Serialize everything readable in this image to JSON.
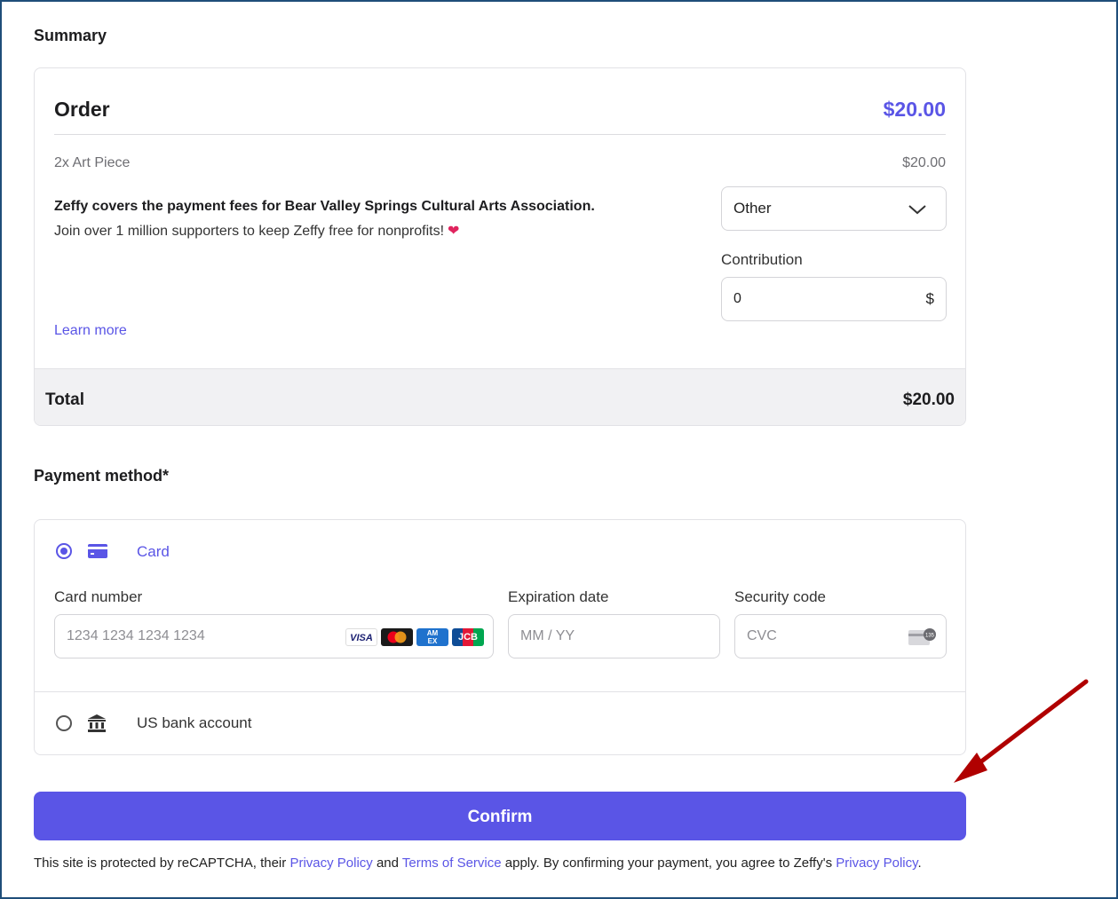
{
  "summary": {
    "title": "Summary",
    "order": {
      "title": "Order",
      "amount": "$20.00",
      "item_name": "2x Art Piece",
      "item_price": "$20.00",
      "fee_bold": "Zeffy covers the payment fees for Bear Valley Springs Cultural Arts Association.",
      "fee_text": "Join over 1 million supporters to keep Zeffy free for nonprofits!",
      "heart_icon": "heart-icon",
      "learn_more": "Learn more",
      "tip_select": {
        "value": "Other"
      },
      "contribution": {
        "label": "Contribution",
        "value": "0",
        "currency": "$"
      }
    },
    "total": {
      "label": "Total",
      "amount": "$20.00"
    }
  },
  "payment": {
    "title": "Payment method*",
    "card_option": {
      "label": "Card",
      "selected": true,
      "icon": "credit-card-icon"
    },
    "card_number": {
      "label": "Card number",
      "placeholder": "1234 1234 1234 1234"
    },
    "card_brands": {
      "visa": "VISA",
      "amex_top": "AM",
      "amex_bottom": "EX",
      "jcb": "JCB"
    },
    "expiration": {
      "label": "Expiration date",
      "placeholder": "MM / YY"
    },
    "security": {
      "label": "Security code",
      "placeholder": "CVC",
      "cvc_icon_text": "135"
    },
    "bank_option": {
      "label": "US bank account",
      "selected": false,
      "icon": "bank-icon"
    }
  },
  "confirm": {
    "label": "Confirm"
  },
  "legal": {
    "part1": "This site is protected by reCAPTCHA, their ",
    "privacy_link": "Privacy Policy",
    "part2": " and ",
    "terms_link": "Terms of Service",
    "part3": " apply. By confirming your payment, you agree to Zeffy's ",
    "zeffy_privacy_link": "Privacy Policy",
    "part4": "."
  },
  "colors": {
    "accent": "#5a55e6",
    "annotation_arrow": "#b00000",
    "total_bg": "#f1f1f3"
  }
}
